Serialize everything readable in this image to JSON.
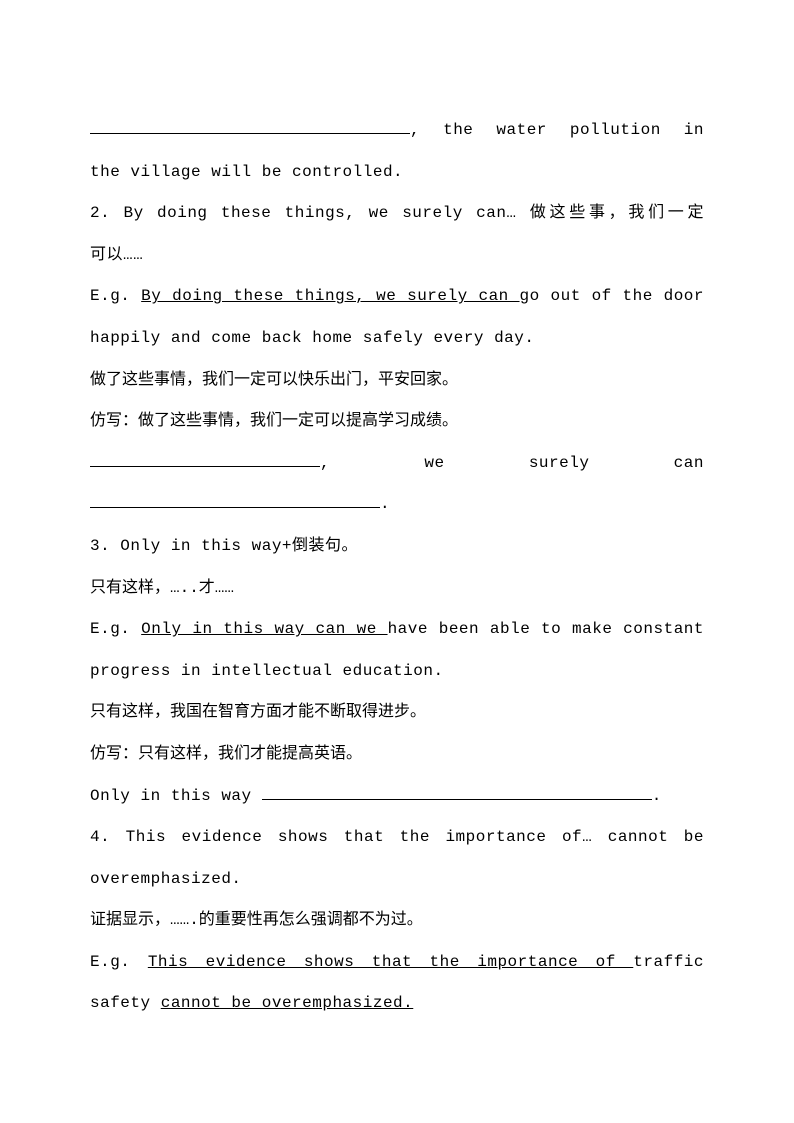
{
  "lines": {
    "l1a": ", the water pollution in",
    "l1b": "the village will be controlled.",
    "l2a": "2. By doing these things, we surely can… 做这些事，我们一定",
    "l2b": "可以……",
    "l3a_pre": "E.g. ",
    "l3a_u": "By doing these things, we surely can ",
    "l3a_post": "go out of the door",
    "l3b": "happily and come back home safely every day.",
    "l4": "做了这些事情，我们一定可以快乐出门，平安回家。",
    "l5": "仿写：做了这些事情，我们一定可以提高学习成绩。",
    "l6_a": ",",
    "l6_b": "we",
    "l6_c": "surely",
    "l6_d": "can",
    "l7_post": ".",
    "l8": "3. Only in this way+倒装句。",
    "l9": "只有这样，…..才……",
    "l10_pre": "E.g. ",
    "l10_u": "Only in this way can we ",
    "l10_post": "have been able to make constant",
    "l10b": "progress in intellectual education.",
    "l11": "只有这样，我国在智育方面才能不断取得进步。",
    "l12": "仿写：只有这样，我们才能提高英语。",
    "l13_a": "Only in this way ",
    "l13_b": ".",
    "l14a": "4. This evidence shows that the importance of… cannot be",
    "l14b": "overemphasized.",
    "l15": "证据显示，…….的重要性再怎么强调都不为过。",
    "l16_pre": "E.g. ",
    "l16_u1": "This evidence shows that the importance of ",
    "l16_mid": "traffic",
    "l16b_a": "safety ",
    "l16b_u": "cannot be overemphasized."
  }
}
